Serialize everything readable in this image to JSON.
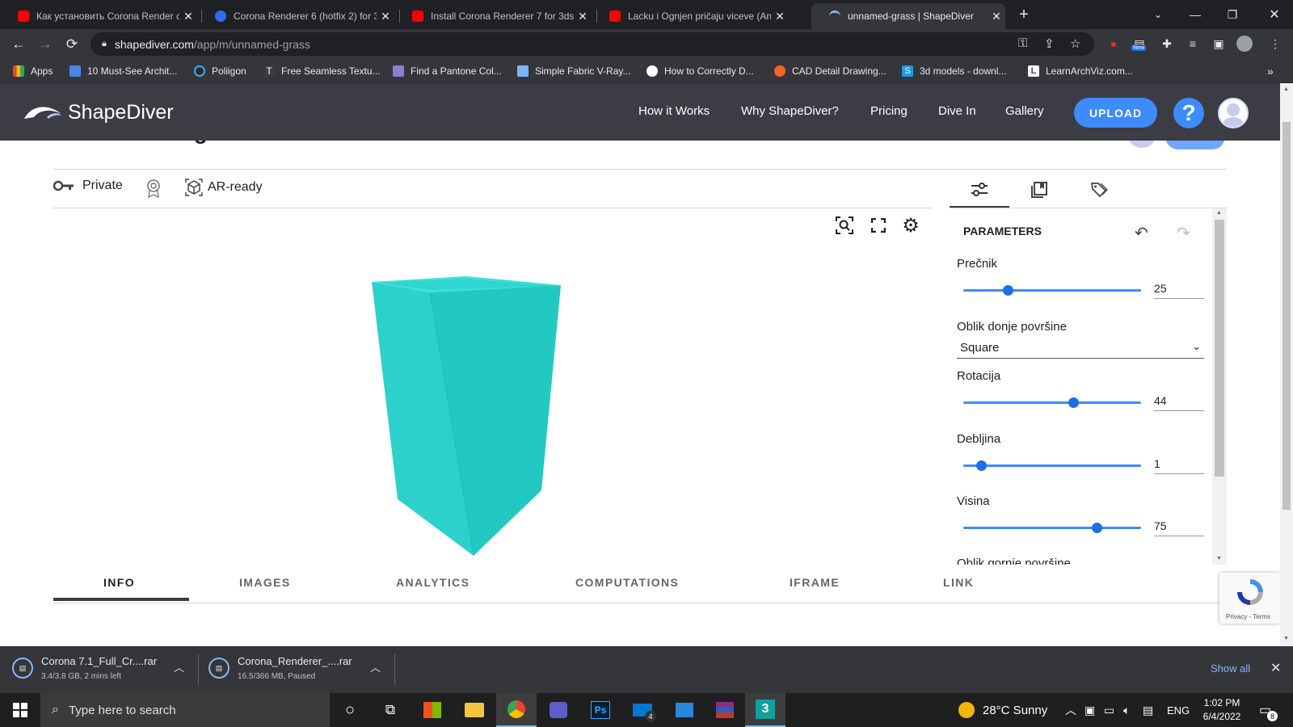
{
  "browser": {
    "tabs": [
      {
        "title": "Как установить Corona Render c",
        "favicon": "youtube-icon",
        "active": false
      },
      {
        "title": "Corona Renderer 6 (hotfix 2) for 3",
        "favicon": "corona-icon",
        "active": false
      },
      {
        "title": "Install Corona Renderer 7 for 3ds",
        "favicon": "youtube-icon",
        "active": false
      },
      {
        "title": "Lacku i Ognjen pričaju viceve (An",
        "favicon": "youtube-icon",
        "active": false
      },
      {
        "title": "unnamed-grass | ShapeDiver",
        "favicon": "shapediver-icon",
        "active": true
      }
    ],
    "url_host": "shapediver.com",
    "url_path": "/app/m/unnamed-grass",
    "extension_badge": "New",
    "bookmarks": [
      {
        "label": "Apps"
      },
      {
        "label": "10 Must-See Archit..."
      },
      {
        "label": "Poliigon"
      },
      {
        "label": "Free Seamless Textu..."
      },
      {
        "label": "Find a Pantone Col..."
      },
      {
        "label": "Simple Fabric V-Ray..."
      },
      {
        "label": "How to Correctly D..."
      },
      {
        "label": "CAD Detail Drawing..."
      },
      {
        "label": "3d models - downl..."
      },
      {
        "label": "LearnArchViz.com..."
      }
    ]
  },
  "site": {
    "logo_text": "ShapeDiver",
    "nav": [
      "How it Works",
      "Why ShapeDiver?",
      "Pricing",
      "Dive In",
      "Gallery"
    ],
    "upload_label": "UPLOAD",
    "help_label": "?"
  },
  "model": {
    "title_partial": "unnamed-grass",
    "visibility": "Private",
    "ar_label": "AR-ready",
    "shape_color": "#2dd1cb"
  },
  "parameters": {
    "heading": "PARAMETERS",
    "items": [
      {
        "label": "Prečnik",
        "type": "slider",
        "value": "25",
        "fraction": 0.25
      },
      {
        "label": "Oblik donje površine",
        "type": "select",
        "value": "Square"
      },
      {
        "label": "Rotacija",
        "type": "slider",
        "value": "44",
        "fraction": 0.62
      },
      {
        "label": "Debljina",
        "type": "slider",
        "value": "1",
        "fraction": 0.1
      },
      {
        "label": "Visina",
        "type": "slider",
        "value": "75",
        "fraction": 0.75
      }
    ],
    "cut_label": "Oblik gornje površine"
  },
  "bottom_tabs": [
    "INFO",
    "IMAGES",
    "ANALYTICS",
    "COMPUTATIONS",
    "IFRAME",
    "LINK"
  ],
  "recaptcha_text": "Privacy - Terms",
  "downloads": [
    {
      "name": "Corona 7.1_Full_Cr....rar",
      "status": "3.4/3.8 GB, 2 mins left"
    },
    {
      "name": "Corona_Renderer_....rar",
      "status": "16.5/366 MB, Paused"
    }
  ],
  "show_all": "Show all",
  "taskbar": {
    "search_placeholder": "Type here to search",
    "weather": "28°C  Sunny",
    "lang": "ENG",
    "time": "1:02 PM",
    "date": "6/4/2022",
    "notif_count": "8",
    "mail_badge": "4"
  }
}
